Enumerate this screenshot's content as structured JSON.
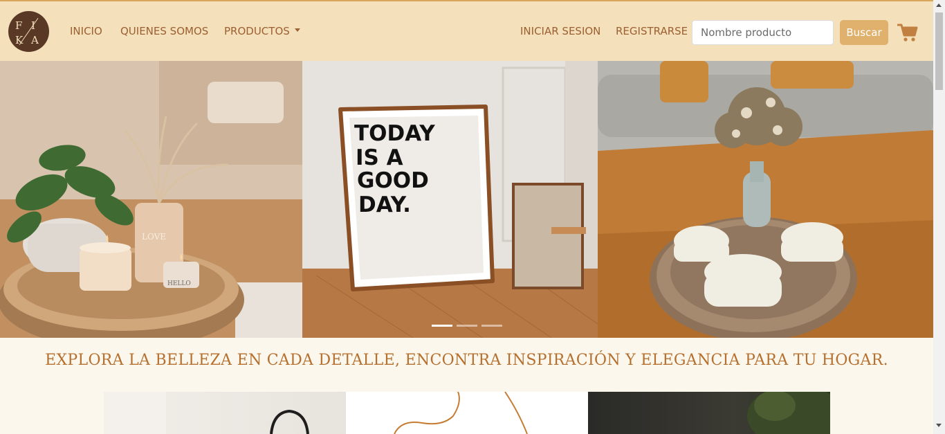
{
  "brand": {
    "logo_letters": [
      "F",
      "I",
      "K",
      "A"
    ]
  },
  "nav": {
    "items": [
      {
        "label": "INICIO"
      },
      {
        "label": "QUIENES SOMOS"
      },
      {
        "label": "PRODUCTOS",
        "dropdown": true
      }
    ],
    "right_items": [
      {
        "label": "INICIAR SESION"
      },
      {
        "label": "REGISTRARSE"
      }
    ]
  },
  "search": {
    "placeholder": "Nombre producto",
    "value": "",
    "button_label": "Buscar"
  },
  "cart": {
    "icon": "shopping-cart-icon"
  },
  "carousel": {
    "slides": [
      {
        "subject": "plant-tray-candles"
      },
      {
        "subject": "framed-print",
        "print_text": [
          "TODAY",
          "IS A",
          "GOOD",
          "DAY."
        ]
      },
      {
        "subject": "dried-flowers-candles"
      }
    ],
    "candle_labels": [
      "LOVE",
      "HELLO"
    ],
    "indicator_count": 3,
    "active_index": 0
  },
  "tagline": "EXPLORA LA BELLEZA EN CADA DETALLE, ENCONTRA INSPIRACIÓN Y ELEGANCIA PARA TU HOGAR.",
  "colors": {
    "navbar_bg": "#f4e1bc",
    "accent": "#e0b06d",
    "nav_text": "#9b5f31",
    "logo_bg": "#5a3826",
    "tagline_text": "#b5702f",
    "page_bg": "#fcf7ec"
  }
}
